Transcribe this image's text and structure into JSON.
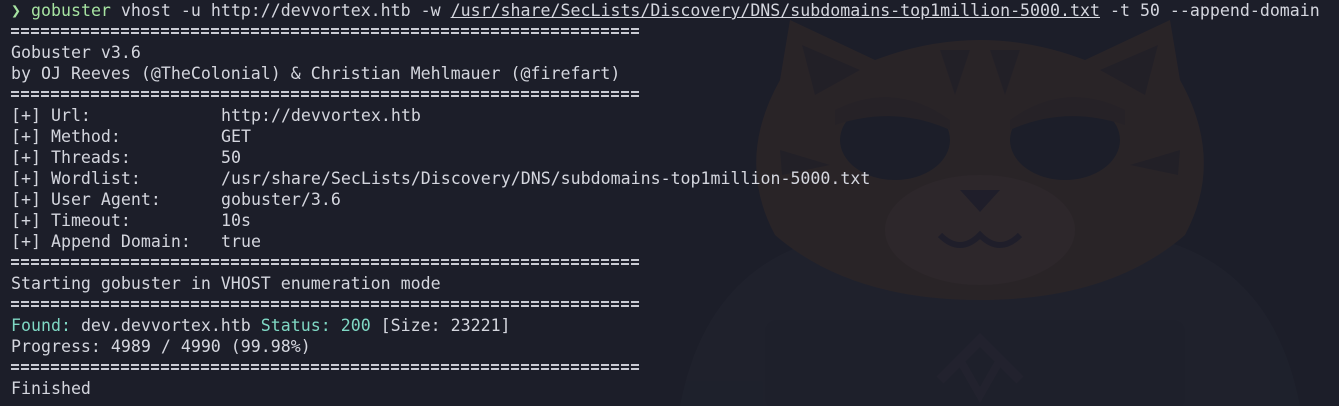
{
  "command": {
    "prompt_symbol": "❯",
    "program": "gobuster",
    "args_before_path": " vhost -u http://devvortex.htb -w ",
    "wordlist_path": "/usr/share/SecLists/Discovery/DNS/subdomains-top1million-5000.txt",
    "args_after_path": " -t 50 --append-domain"
  },
  "banner": {
    "version": "Gobuster v3.6",
    "authors": "by OJ Reeves (@TheColonial) & Christian Mehlmauer (@firefart)"
  },
  "config": [
    {
      "key": "[+] Url:",
      "value": "http://devvortex.htb"
    },
    {
      "key": "[+] Method:",
      "value": "GET"
    },
    {
      "key": "[+] Threads:",
      "value": "50"
    },
    {
      "key": "[+] Wordlist:",
      "value": "/usr/share/SecLists/Discovery/DNS/subdomains-top1million-5000.txt"
    },
    {
      "key": "[+] User Agent:",
      "value": "gobuster/3.6"
    },
    {
      "key": "[+] Timeout:",
      "value": "10s"
    },
    {
      "key": "[+] Append Domain:",
      "value": "true"
    }
  ],
  "start_message": "Starting gobuster in VHOST enumeration mode",
  "result": {
    "found_label": "Found:",
    "host": " dev.devvortex.htb ",
    "status_label": "Status:",
    "status_code": " 200",
    "size": " [Size: 23221]"
  },
  "progress": "Progress: 4989 / 4990 (99.98%)",
  "finish_message": "Finished",
  "colors": {
    "background": "#1c1e29",
    "text": "#d4d6de",
    "prompt_green": "#a6e3a1",
    "found_teal": "#7fd8c4"
  }
}
